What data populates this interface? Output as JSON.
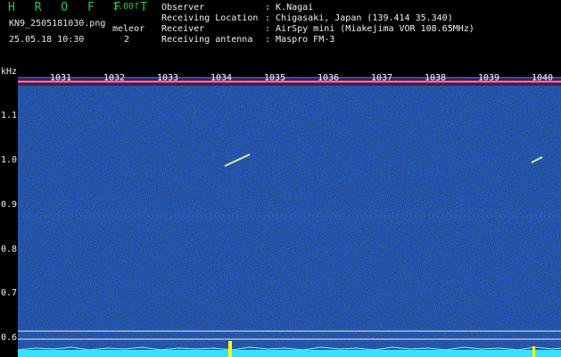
{
  "header": {
    "app_title": "H R O F F T",
    "version": "1.00f",
    "filename": "KN9_2505181030.png",
    "datetime": "25.05.18 10:30",
    "mode_label": "meleor",
    "mode_value": "2"
  },
  "station": [
    {
      "label": "Observer",
      "value": ": K.Nagai"
    },
    {
      "label": "Receiving Location",
      "value": ": Chigasaki, Japan (139.414 35.340)"
    },
    {
      "label": "Receiver",
      "value": ": AirSpy mini (Miakejima VOR 108.65MHz)"
    },
    {
      "label": "Receiving antenna",
      "value": ": Maspro FM-3"
    }
  ],
  "y_axis": {
    "unit": "kHz",
    "ticks": [
      "1.1",
      "1.0",
      "0.9",
      "0.8",
      "0.7",
      "0.6"
    ]
  },
  "time_axis": {
    "ticks": [
      "1031",
      "1032",
      "1033",
      "1034",
      "1035",
      "1036",
      "1037",
      "1038",
      "1039",
      "1040"
    ]
  },
  "colors": {
    "background": "#000000",
    "title_green": "#29c84a",
    "noise_blue": "#1a2fb0",
    "baseline_cyan": "#36e0ff",
    "marker_yellow": "#ffff00"
  }
}
